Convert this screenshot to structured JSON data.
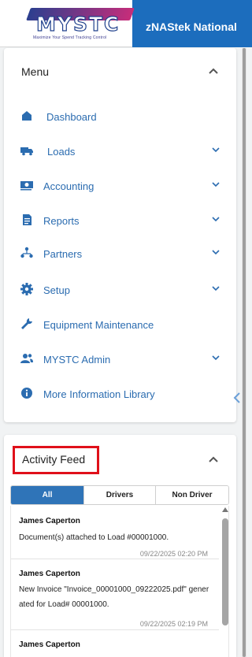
{
  "header": {
    "logo_text": "MYSTC",
    "logo_tagline": "Maximize Your Spend Tracking Control",
    "company_name": "zNAStek National"
  },
  "menu": {
    "title": "Menu",
    "items": [
      {
        "label": "Dashboard",
        "icon": "home-icon",
        "expandable": false
      },
      {
        "label": "Loads",
        "icon": "truck-icon",
        "expandable": true
      },
      {
        "label": "Accounting",
        "icon": "money-icon",
        "expandable": true
      },
      {
        "label": "Reports",
        "icon": "report-icon",
        "expandable": true
      },
      {
        "label": "Partners",
        "icon": "partners-icon",
        "expandable": true
      },
      {
        "label": "Setup",
        "icon": "gear-icon",
        "expandable": true
      },
      {
        "label": "Equipment Maintenance",
        "icon": "wrench-icon",
        "expandable": false
      },
      {
        "label": "MYSTC Admin",
        "icon": "admin-users-icon",
        "expandable": true
      },
      {
        "label": "More Information Library",
        "icon": "info-icon",
        "expandable": false
      }
    ]
  },
  "activity": {
    "title": "Activity Feed",
    "tabs": [
      "All",
      "Drivers",
      "Non Driver"
    ],
    "active_tab": "All",
    "items": [
      {
        "name": "James Caperton",
        "message": "Document(s) attached to Load #00001000.",
        "timestamp": "09/22/2025 02:20 PM"
      },
      {
        "name": "James Caperton",
        "message": "New Invoice \"Invoice_00001000_09222025.pdf\" generated for Load# 00001000.",
        "timestamp": "09/22/2025 02:19 PM"
      },
      {
        "name": "James Caperton",
        "message": "",
        "timestamp": ""
      }
    ]
  },
  "colors": {
    "header_blue": "#1c6dbd",
    "link_blue": "#2b6cb0",
    "tab_active": "#2f74b8",
    "highlight_red": "#e0101a"
  }
}
